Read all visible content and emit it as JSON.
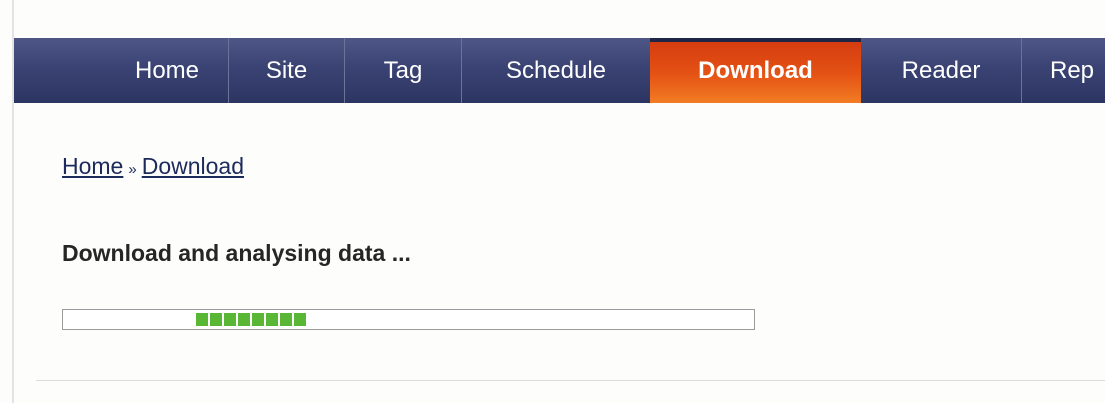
{
  "nav": {
    "items": [
      {
        "label": "Home",
        "active": false
      },
      {
        "label": "Site",
        "active": false
      },
      {
        "label": "Tag",
        "active": false
      },
      {
        "label": "Schedule",
        "active": false
      },
      {
        "label": "Download",
        "active": true
      },
      {
        "label": "Reader",
        "active": false
      },
      {
        "label": "Rep",
        "active": false
      }
    ],
    "colors": {
      "bar": "#3a4373",
      "active": "#e45214",
      "text": "#ffffff"
    }
  },
  "breadcrumb": {
    "home_label": "Home",
    "separator": "»",
    "current_label": "Download"
  },
  "main": {
    "status_text": "Download and analysing data ..."
  },
  "progress": {
    "blocks_filled": 8,
    "color": "#5ab635"
  }
}
